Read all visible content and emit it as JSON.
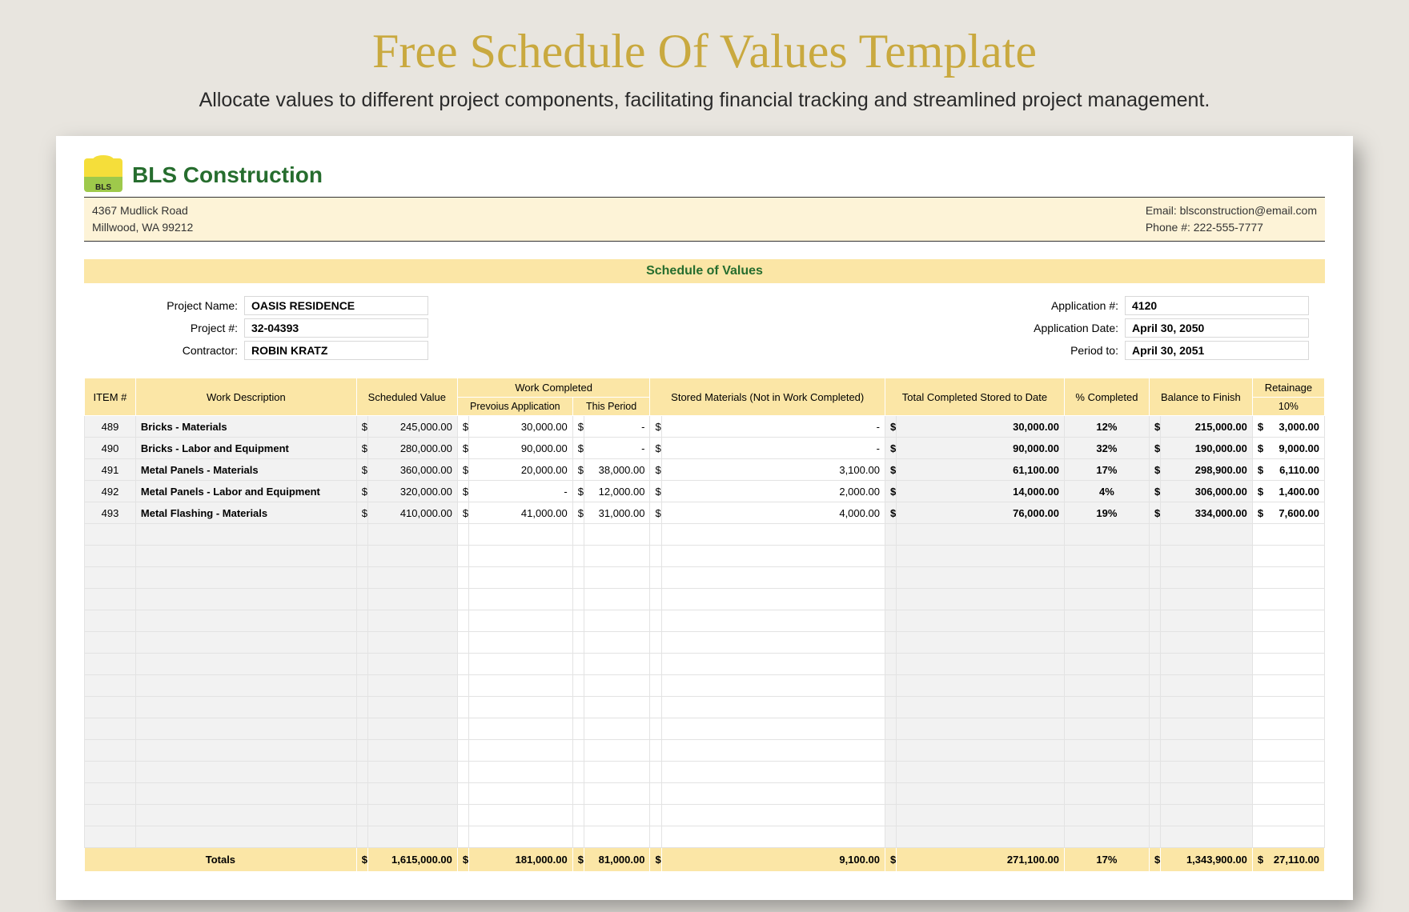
{
  "title": "Free Schedule Of Values Template",
  "subtitle": "Allocate values to different project components, facilitating financial tracking and streamlined project management.",
  "company": {
    "name": "BLS Construction",
    "logo_text": "BLS",
    "address1": "4367 Mudlick Road",
    "address2": "Millwood, WA 99212",
    "email_label": "Email: blsconstruction@email.com",
    "phone_label": "Phone #: 222-555-7777"
  },
  "banner": "Schedule of Values",
  "meta": {
    "left": {
      "project_name_label": "Project Name:",
      "project_name": "OASIS RESIDENCE",
      "project_no_label": "Project #:",
      "project_no": "32-04393",
      "contractor_label": "Contractor:",
      "contractor": "ROBIN KRATZ"
    },
    "right": {
      "app_no_label": "Application #:",
      "app_no": "4120",
      "app_date_label": "Application Date:",
      "app_date": "April 30, 2050",
      "period_label": "Period to:",
      "period": "April 30, 2051"
    }
  },
  "columns": {
    "item": "ITEM #",
    "desc": "Work Description",
    "scheduled": "Scheduled Value",
    "work_completed": "Work Completed",
    "prev": "Prevoius Application",
    "this_period": "This Period",
    "stored": "Stored Materials (Not in Work Completed)",
    "total_stored": "Total Completed Stored to Date",
    "pct": "% Completed",
    "balance": "Balance to Finish",
    "retainage": "Retainage",
    "retainage_pct": "10%"
  },
  "rows": [
    {
      "item": "489",
      "desc": "Bricks - Materials",
      "scheduled": "245,000.00",
      "prev": "30,000.00",
      "this": "-",
      "stored": "-",
      "total": "30,000.00",
      "pct": "12%",
      "balance": "215,000.00",
      "ret": "3,000.00"
    },
    {
      "item": "490",
      "desc": "Bricks - Labor and Equipment",
      "scheduled": "280,000.00",
      "prev": "90,000.00",
      "this": "-",
      "stored": "-",
      "total": "90,000.00",
      "pct": "32%",
      "balance": "190,000.00",
      "ret": "9,000.00"
    },
    {
      "item": "491",
      "desc": "Metal Panels - Materials",
      "scheduled": "360,000.00",
      "prev": "20,000.00",
      "this": "38,000.00",
      "stored": "3,100.00",
      "total": "61,100.00",
      "pct": "17%",
      "balance": "298,900.00",
      "ret": "6,110.00"
    },
    {
      "item": "492",
      "desc": "Metal Panels - Labor and Equipment",
      "scheduled": "320,000.00",
      "prev": "-",
      "this": "12,000.00",
      "stored": "2,000.00",
      "total": "14,000.00",
      "pct": "4%",
      "balance": "306,000.00",
      "ret": "1,400.00"
    },
    {
      "item": "493",
      "desc": "Metal Flashing - Materials",
      "scheduled": "410,000.00",
      "prev": "41,000.00",
      "this": "31,000.00",
      "stored": "4,000.00",
      "total": "76,000.00",
      "pct": "19%",
      "balance": "334,000.00",
      "ret": "7,600.00"
    }
  ],
  "empty_rows": 15,
  "totals": {
    "label": "Totals",
    "scheduled": "1,615,000.00",
    "prev": "181,000.00",
    "this": "81,000.00",
    "stored": "9,100.00",
    "total": "271,100.00",
    "pct": "17%",
    "balance": "1,343,900.00",
    "ret": "27,110.00"
  },
  "dollar": "$"
}
